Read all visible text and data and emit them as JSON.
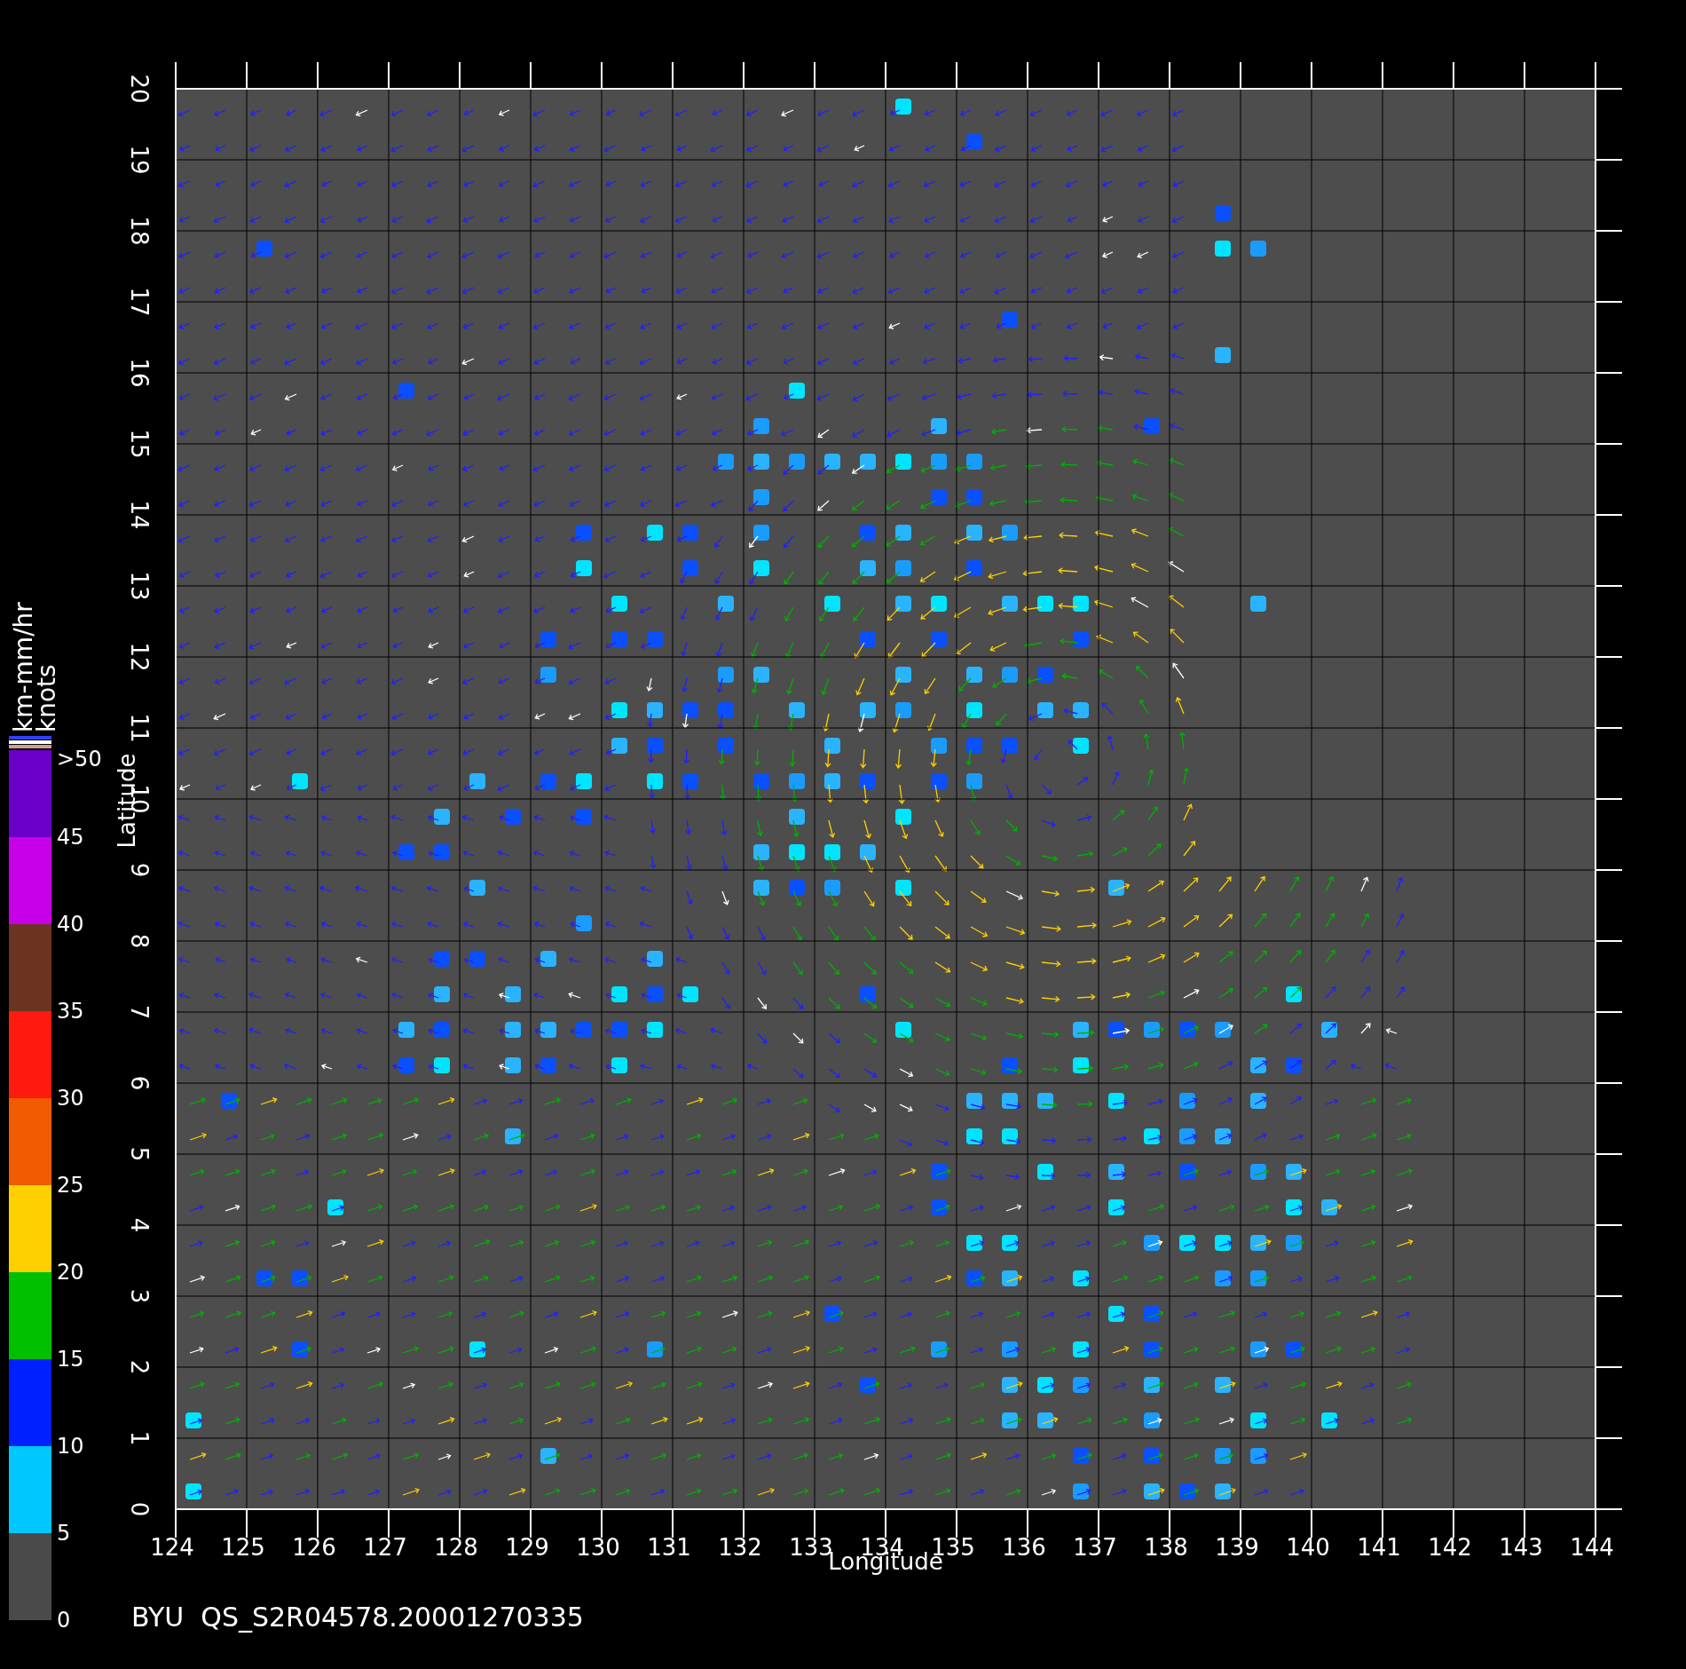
{
  "plot": {
    "x_axis": {
      "label": "Longitude",
      "ticks": [
        "124",
        "125",
        "126",
        "127",
        "128",
        "129",
        "130",
        "131",
        "132",
        "133",
        "134",
        "135",
        "136",
        "137",
        "138",
        "139",
        "140",
        "141",
        "142",
        "143",
        "144"
      ]
    },
    "y_axis": {
      "label": "Latitude",
      "ticks": [
        "0",
        "1",
        "2",
        "3",
        "4",
        "5",
        "6",
        "7",
        "8",
        "9",
        "10",
        "11",
        "12",
        "13",
        "14",
        "15",
        "16",
        "17",
        "18",
        "19",
        "20"
      ]
    }
  },
  "colorbar": {
    "units": [
      "km-mm/hr",
      "knots"
    ],
    "segments": [
      {
        "color": "#6a00c8"
      },
      {
        "color": "#c800e8"
      },
      {
        "color": "#6b3320"
      },
      {
        "color": "#ff1a10"
      },
      {
        "color": "#f05a00"
      },
      {
        "color": "#ffd000"
      },
      {
        "color": "#00c000"
      },
      {
        "color": "#0020ff"
      },
      {
        "color": "#00c8ff"
      },
      {
        "color": "#4a4a4a"
      }
    ],
    "ticks": [
      ">50",
      "45",
      "40",
      "35",
      "30",
      "25",
      "20",
      "15",
      "10",
      "5",
      "0"
    ]
  },
  "caption": "BYU  QS_S2R04578.20001270335"
}
